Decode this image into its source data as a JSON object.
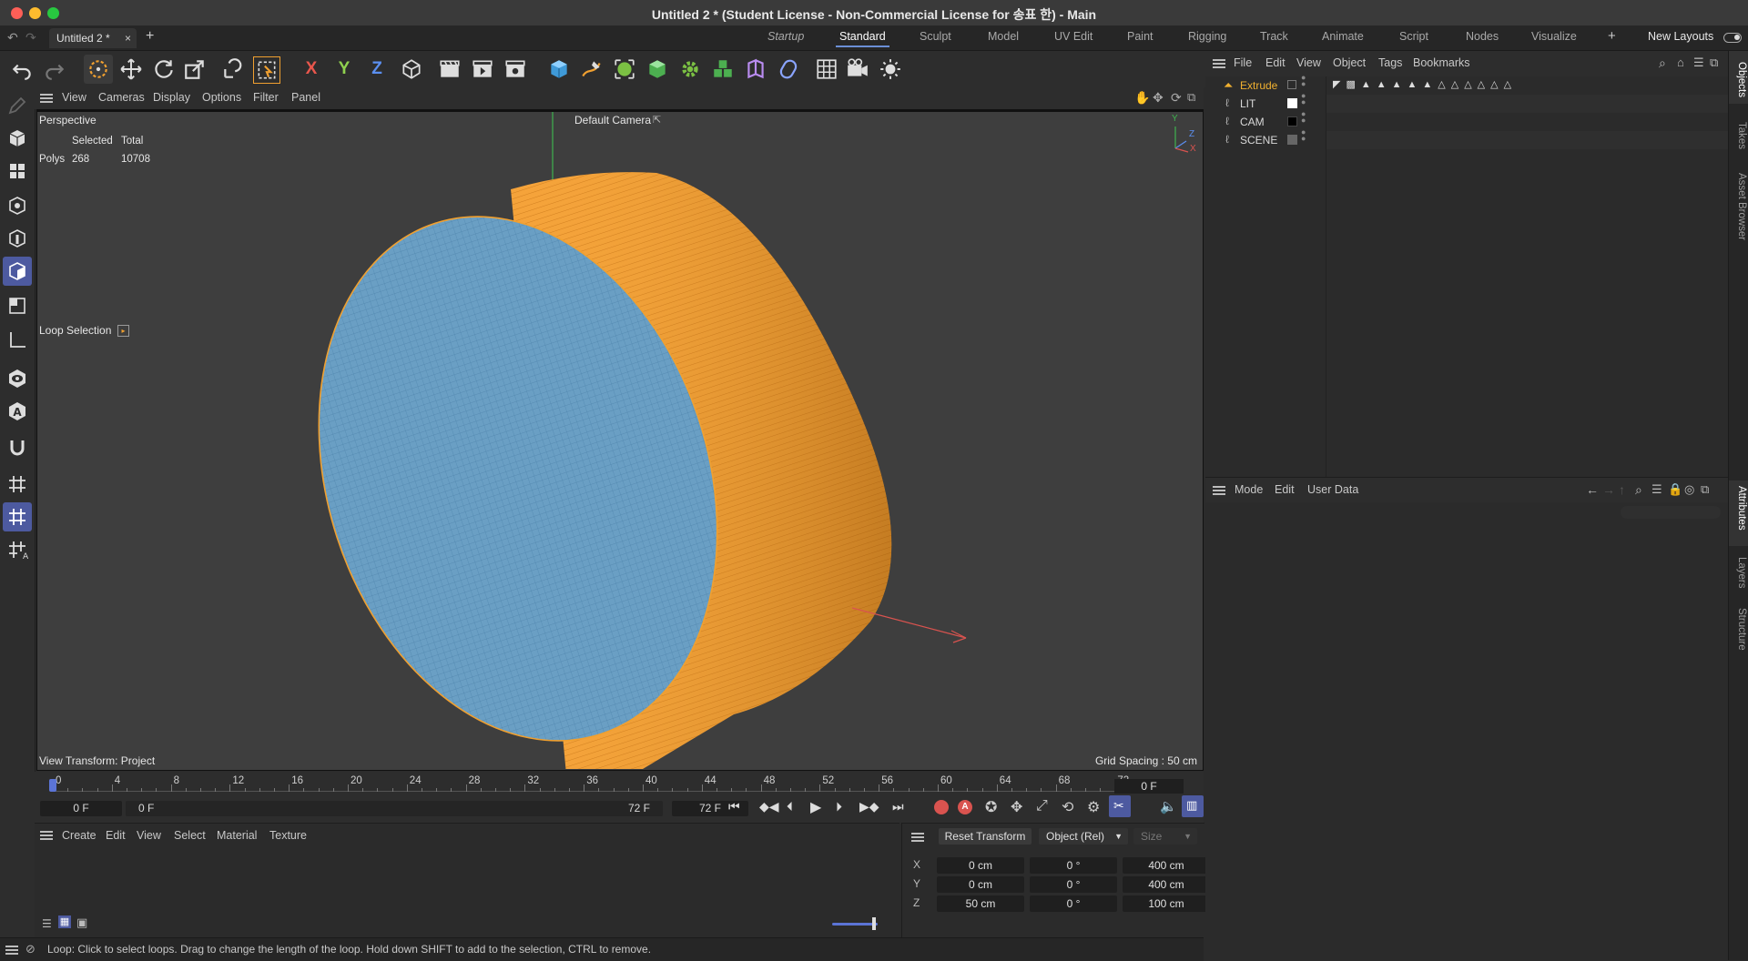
{
  "window": {
    "title": "Untitled 2 * (Student License - Non-Commercial License for 송표 한) - Main"
  },
  "tabs": {
    "document": "Untitled 2 *",
    "close": "×",
    "add": "+"
  },
  "layouts": {
    "items": [
      "Startup",
      "Standard",
      "Sculpt",
      "Model",
      "UV Edit",
      "Paint",
      "Rigging",
      "Track",
      "Animate",
      "Script",
      "Nodes",
      "Visualize"
    ],
    "active": "Standard",
    "add": "+",
    "new_layouts": "New Layouts"
  },
  "toolbar": {
    "axis_x": "X",
    "axis_y": "Y",
    "axis_z": "Z"
  },
  "viewport_menu": {
    "items": [
      "View",
      "Cameras",
      "Display",
      "Options",
      "Filter",
      "Panel"
    ]
  },
  "viewport": {
    "projection": "Perspective",
    "camera": "Default Camera",
    "stats": {
      "col_selected": "Selected",
      "col_total": "Total",
      "row_label": "Polys",
      "selected": "268",
      "total": "10708"
    },
    "tool": "Loop Selection",
    "view_transform": "View Transform: Project",
    "grid_spacing": "Grid Spacing : 50 cm",
    "axis_labels": {
      "y": "Y",
      "z": "Z",
      "x": "X"
    }
  },
  "timeline": {
    "ticks": [
      "0",
      "4",
      "8",
      "12",
      "16",
      "20",
      "24",
      "28",
      "32",
      "36",
      "40",
      "44",
      "48",
      "52",
      "56",
      "60",
      "64",
      "68",
      "72"
    ],
    "current_frame": "0 F",
    "start": "0 F",
    "min": "0 F",
    "max": "72 F",
    "end": "72 F"
  },
  "material_menu": {
    "items": [
      "Create",
      "Edit",
      "View",
      "Select",
      "Material",
      "Texture"
    ]
  },
  "coords": {
    "reset": "Reset Transform",
    "mode": "Object (Rel)",
    "size": "Size",
    "rows": [
      {
        "axis": "X",
        "pos": "0 cm",
        "rot": "0 °",
        "size": "400 cm"
      },
      {
        "axis": "Y",
        "pos": "0 cm",
        "rot": "0 °",
        "size": "400 cm"
      },
      {
        "axis": "Z",
        "pos": "50 cm",
        "rot": "0 °",
        "size": "100 cm"
      }
    ]
  },
  "status": {
    "text": "Loop: Click to select loops. Drag to change the length of the loop. Hold down SHIFT to add to the selection, CTRL to remove."
  },
  "object_menu": {
    "items": [
      "File",
      "Edit",
      "View",
      "Object",
      "Tags",
      "Bookmarks"
    ]
  },
  "objects": [
    {
      "name": "Extrude",
      "selected": true,
      "swatch": "#2b2b2b"
    },
    {
      "name": "LIT",
      "selected": false,
      "swatch": "#ffffff"
    },
    {
      "name": "CAM",
      "selected": false,
      "swatch": "#000000"
    },
    {
      "name": "SCENE",
      "selected": false,
      "swatch": "#666666"
    }
  ],
  "attributes_menu": {
    "items": [
      "Mode",
      "Edit",
      "User Data"
    ]
  },
  "right_tabs": {
    "objects": "Objects",
    "takes": "Takes",
    "asset_browser": "Asset Browser",
    "attributes": "Attributes",
    "layers": "Layers",
    "structure": "Structure"
  },
  "colors": {
    "accent": "#6b8fd6",
    "selection_orange": "#f0a030",
    "extrude_label": "#f0b030",
    "mesh_blue": "#6a9fc4"
  }
}
